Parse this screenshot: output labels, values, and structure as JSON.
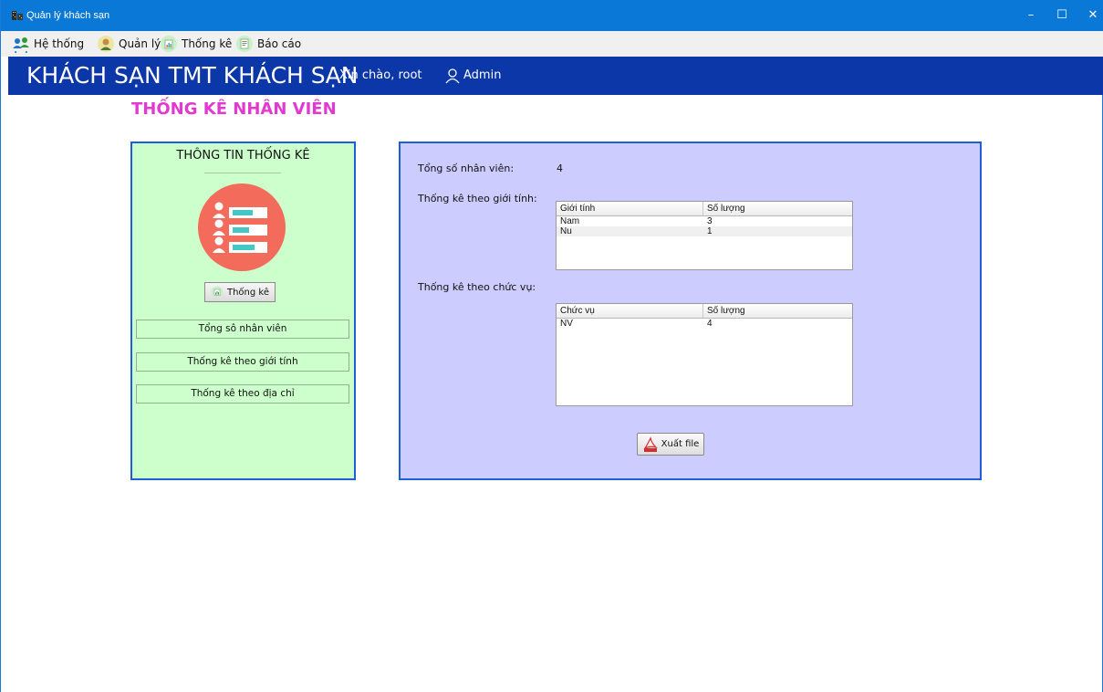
{
  "window": {
    "title": "Quản lý khách sạn",
    "controls": {
      "minimize": "–",
      "maximize": "☐",
      "close": "✕"
    },
    "accent_color": "#0a78d7"
  },
  "menu": {
    "items": [
      {
        "label": "Hệ thống",
        "icon": "users-sync-icon"
      },
      {
        "label": "Quản lý",
        "icon": "manager-icon"
      },
      {
        "label": "Thống kê",
        "icon": "chart-icon"
      },
      {
        "label": "Báo cáo",
        "icon": "report-icon"
      }
    ]
  },
  "header": {
    "hotel_name": "KHÁCH SẠN TMT KHÁCH SẠN",
    "greeting": "Xin chào, root",
    "role": "Admin",
    "background": "#0c37a8"
  },
  "page": {
    "title": "THỐNG KÊ NHÂN VIÊN",
    "title_color": "#e23ad1"
  },
  "left_panel": {
    "title": "THÔNG TIN THỐNG KÊ",
    "stats_button": "Thống kê",
    "options": [
      "Tổng sô nhân viên",
      "Thống kê theo giới tính",
      "Thống kê theo địa chỉ"
    ],
    "background": "#ccffcc"
  },
  "right_panel": {
    "total_label": "Tổng số nhân viên:",
    "total_value": "4",
    "gender_label": "Thống kê theo giới tính:",
    "position_label": "Thống kê theo chức vụ:",
    "gender_table": {
      "headers": [
        "Giới tính",
        "Số lượng"
      ],
      "rows": [
        [
          "Nam",
          "3"
        ],
        [
          "Nu",
          "1"
        ]
      ]
    },
    "position_table": {
      "headers": [
        "Chức vụ",
        "Số lượng"
      ],
      "rows": [
        [
          "NV",
          "4"
        ]
      ]
    },
    "export_button": "Xuất file",
    "background": "#ccccff"
  }
}
